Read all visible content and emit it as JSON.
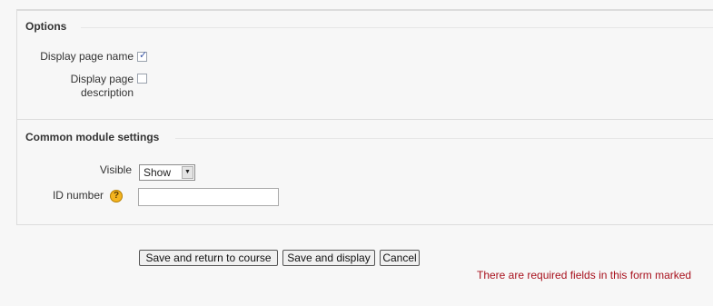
{
  "options": {
    "legend": "Options",
    "display_page_name_label": "Display page name",
    "display_page_name_checked": true,
    "display_page_description_label_line1": "Display page",
    "display_page_description_label_line2": "description",
    "display_page_description_checked": false
  },
  "common": {
    "legend": "Common module settings",
    "visible_label": "Visible",
    "visible_value": "Show",
    "id_number_label": "ID number",
    "id_number_value": "",
    "help_icon_glyph": "?"
  },
  "actions": {
    "save_return_label": "Save and return to course",
    "save_display_label": "Save and display",
    "cancel_label": "Cancel"
  },
  "footer": {
    "required_note": "There are required fields in this form marked"
  },
  "colors": {
    "required_text": "#a8111d",
    "help_icon": "#f4b41f",
    "check_mark": "#3a57a8"
  },
  "icons": {
    "help": "help-icon",
    "dropdown": "chevron-down-icon",
    "check": "check-icon"
  }
}
